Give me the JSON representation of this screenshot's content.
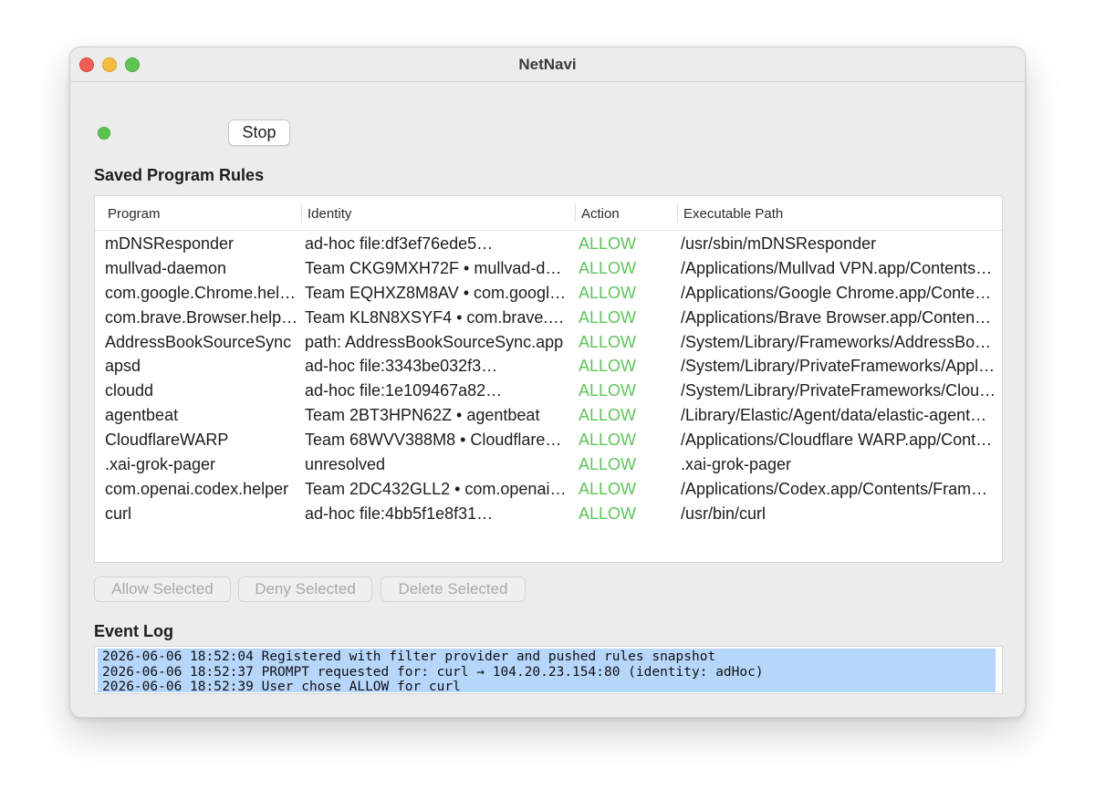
{
  "window": {
    "title": "NetNavi"
  },
  "toolbar": {
    "stop_label": "Stop",
    "status": "running"
  },
  "rules": {
    "title": "Saved Program Rules",
    "columns": [
      "Program",
      "Identity",
      "Action",
      "Executable Path"
    ],
    "rows": [
      {
        "program": "mDNSResponder",
        "identity": "ad-hoc file:df3ef76ede5…",
        "action": "ALLOW",
        "path": "/usr/sbin/mDNSResponder"
      },
      {
        "program": "mullvad-daemon",
        "identity": "Team CKG9MXH72F • mullvad-da…",
        "action": "ALLOW",
        "path": "/Applications/Mullvad VPN.app/Contents…"
      },
      {
        "program": "com.google.Chrome.hel…",
        "identity": "Team EQHXZ8M8AV • com.googl…",
        "action": "ALLOW",
        "path": "/Applications/Google Chrome.app/Conte…"
      },
      {
        "program": "com.brave.Browser.help…",
        "identity": "Team KL8N8XSYF4 • com.brave.…",
        "action": "ALLOW",
        "path": "/Applications/Brave Browser.app/Conten…"
      },
      {
        "program": "AddressBookSourceSync",
        "identity": "path: AddressBookSourceSync.app",
        "action": "ALLOW",
        "path": "/System/Library/Frameworks/AddressBo…"
      },
      {
        "program": "apsd",
        "identity": "ad-hoc file:3343be032f3…",
        "action": "ALLOW",
        "path": "/System/Library/PrivateFrameworks/Appl…"
      },
      {
        "program": "cloudd",
        "identity": "ad-hoc file:1e109467a82…",
        "action": "ALLOW",
        "path": "/System/Library/PrivateFrameworks/Clou…"
      },
      {
        "program": "agentbeat",
        "identity": "Team 2BT3HPN62Z • agentbeat",
        "action": "ALLOW",
        "path": "/Library/Elastic/Agent/data/elastic-agent…"
      },
      {
        "program": "CloudflareWARP",
        "identity": "Team 68WVV388M8 • Cloudflare…",
        "action": "ALLOW",
        "path": "/Applications/Cloudflare WARP.app/Cont…"
      },
      {
        "program": ".xai-grok-pager",
        "identity": "unresolved",
        "action": "ALLOW",
        "path": ".xai-grok-pager"
      },
      {
        "program": "com.openai.codex.helper",
        "identity": "Team 2DC432GLL2 • com.openai.…",
        "action": "ALLOW",
        "path": "/Applications/Codex.app/Contents/Fram…"
      },
      {
        "program": "curl",
        "identity": "ad-hoc file:4bb5f1e8f31…",
        "action": "ALLOW",
        "path": "/usr/bin/curl"
      }
    ]
  },
  "actions": {
    "allow_label": "Allow Selected",
    "deny_label": "Deny Selected",
    "delete_label": "Delete Selected"
  },
  "log": {
    "title": "Event Log",
    "lines": [
      "2026-06-06 18:52:04 Registered with filter provider and pushed rules snapshot",
      "2026-06-06 18:52:37 PROMPT requested for: curl → 104.20.23.154:80 (identity: adHoc)",
      "2026-06-06 18:52:39 User chose ALLOW for curl"
    ]
  },
  "colors": {
    "allow": "#5ec45a",
    "status_running": "#5ac34c",
    "log_selection": "#b7d6fb",
    "traffic_close": "#ee5f57",
    "traffic_minimize": "#f4bd3e",
    "traffic_maximize": "#5fc453"
  }
}
